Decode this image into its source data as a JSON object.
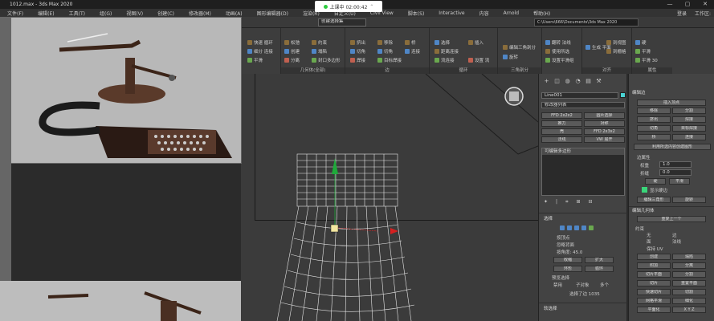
{
  "window": {
    "title": "1012.max - 3ds Max 2020",
    "controls": [
      "—",
      "▢",
      "✕"
    ]
  },
  "recording": {
    "status": "上课中 02:00:42",
    "chevron": "⌃"
  },
  "menu": {
    "items": [
      "文件(F)",
      "编辑(E)",
      "工具(T)",
      "组(G)",
      "视图(V)",
      "创建(C)",
      "修改器(M)",
      "动画(A)",
      "图形编辑器(D)",
      "渲染(R)",
      "自定义(U)",
      "Civil View",
      "脚本(S)",
      "Interactive",
      "内容",
      "Arnold",
      "帮助(H)"
    ],
    "sign_in": "登录",
    "workspace": "工作区:"
  },
  "toolbar": {
    "path": "C:\\Users\\666\\Documents\\3ds Max 2020",
    "dropdown": "创建选择集"
  },
  "ribbon": {
    "groups": [
      {
        "label": "",
        "buttons": [
          "快速 循环",
          "细分 连接",
          "平滑"
        ]
      },
      {
        "label": "几何体(全部)",
        "buttons": [
          "松弛",
          "创建",
          "分离",
          "约束",
          "塌陷",
          "附加",
          "封口多边形",
          "切片",
          "附加",
          "快速切片",
          "快速切片",
          "剪切"
        ]
      },
      {
        "label": "边",
        "buttons": [
          "挤出",
          "切角",
          "焊接",
          "移除",
          "切角",
          "目标焊接",
          "桥",
          "连接",
          "利用所选内容"
        ]
      },
      {
        "label": "循环",
        "buttons": [
          "选择",
          "距离连接",
          "流连接",
          "插入",
          "设置 流",
          "移除"
        ]
      },
      {
        "label": "三角剖分",
        "buttons": [
          "编辑三角剖分",
          "旋转"
        ]
      },
      {
        "label": "",
        "buttons": [
          "翻转 法线",
          "使用所选",
          "设置平滑组"
        ]
      },
      {
        "label": "对齐",
        "buttons": [
          "生成 平面",
          "到视图",
          "到栅格"
        ]
      },
      {
        "label": "属性",
        "buttons": [
          "硬",
          "平滑",
          "平滑 30"
        ]
      }
    ]
  },
  "command_panel": {
    "tabs": [
      "+",
      "◫",
      "◍",
      "◔",
      "▤",
      "⚒"
    ],
    "object_name": "Line001",
    "modifier_list": "修改器列表",
    "buttons": [
      [
        "FFD 2x2x2",
        "圆片选择"
      ],
      [
        "推力",
        "对称"
      ],
      [
        "壳",
        "FFD 2x3x2"
      ],
      [
        "法线",
        "VW 展开"
      ]
    ],
    "stack_item": "可编辑多边形",
    "stack_icons": [
      "✦",
      "|",
      "⌗",
      "⊞",
      "⊟"
    ],
    "selection": {
      "header": "选择",
      "options": [
        "按顶点",
        "忽略背面",
        "按角度: 45.0"
      ],
      "buttons": [
        "收缩",
        "扩大",
        "环形",
        "循环"
      ],
      "preview": "预览选择",
      "preview_opts": [
        "禁用",
        "子对象",
        "多个"
      ],
      "status": "选择了边 1035"
    },
    "soft_select": "软选择"
  },
  "edit_edges": {
    "header": "编辑边",
    "buttons": [
      [
        "插入顶点"
      ],
      [
        "移除",
        "分割"
      ],
      [
        "挤出",
        "焊接"
      ],
      [
        "切角",
        "目标焊接"
      ],
      [
        "桥",
        "连接"
      ]
    ],
    "create_shape": "利用所选内容创建图形",
    "weight_lbl": "权重",
    "weight": "1.0",
    "crease_lbl": "折缝",
    "crease": "0.0",
    "hard": "硬",
    "smooth": "平滑",
    "show_hard": "显示硬边",
    "tri_buttons": [
      "编辑三角形",
      "旋转"
    ],
    "geom_header": "编辑几何体",
    "repeat": "重复上一个",
    "constraint_lbl": "约束",
    "constraints": [
      "无",
      "边",
      "面",
      "法线"
    ],
    "preserve_uv": "保持 UV",
    "geom_buttons": [
      [
        "创建",
        "塌陷"
      ],
      [
        "附加",
        "分离"
      ],
      [
        "切片平面",
        "分割"
      ],
      [
        "切片",
        "重置平面"
      ],
      [
        "快速切片",
        "切割"
      ],
      [
        "网格平滑",
        "细化"
      ],
      [
        "平面化",
        "X Y Z"
      ],
      [
        "视图对齐",
        "栅格对齐"
      ]
    ]
  },
  "colors": {
    "accent": "#4ad3d3",
    "green_swatch": "#3ad67a",
    "bg": "#2b2b2b",
    "gizmo_y": "#1faa3a",
    "gizmo_x": "#d62020"
  }
}
